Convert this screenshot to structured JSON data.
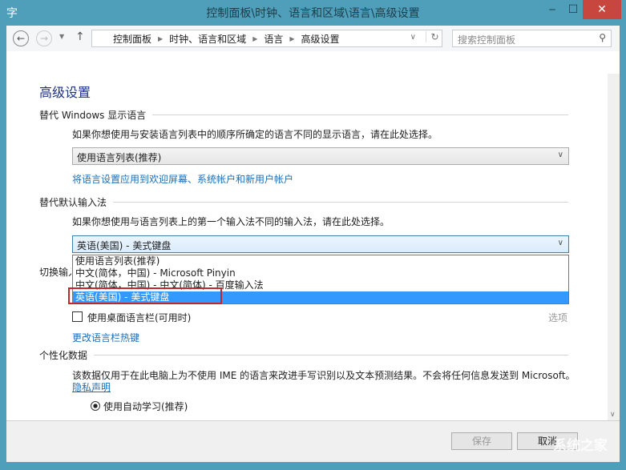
{
  "window": {
    "title": "控制面板\\时钟、语言和区域\\语言\\高级设置"
  },
  "nav": {
    "breadcrumb": [
      "控制面板",
      "时钟、语言和区域",
      "语言",
      "高级设置"
    ],
    "search_placeholder": "搜索控制面板"
  },
  "page": {
    "heading": "高级设置",
    "display_lang": {
      "title": "替代 Windows 显示语言",
      "desc": "如果你想使用与安装语言列表中的顺序所确定的语言不同的显示语言，请在此处选择。",
      "value": "使用语言列表(推荐)",
      "link": "将语言设置应用到欢迎屏幕、系统帐户和新用户帐户"
    },
    "input_method": {
      "title": "替代默认输入法",
      "desc": "如果你想使用与语言列表上的第一个输入法不同的输入法，请在此处选择。",
      "value": "英语(美国) - 美式键盘",
      "options": [
        "使用语言列表(推荐)",
        "中文(简体，中国) - Microsoft Pinyin",
        "中文(简体，中国) - 中文(简体) - 百度输入法",
        "英语(美国) - 美式键盘"
      ],
      "selected_index": 3
    },
    "switch": {
      "title": "切换输入法",
      "checkbox": "使用桌面语言栏(可用时)",
      "checked": false,
      "options_link": "选项",
      "hotkey_link": "更改语言栏热键"
    },
    "personal": {
      "title": "个性化数据",
      "desc": "该数据仅用于在此电脑上为不使用 IME 的语言来改进手写识别以及文本预测结果。不会将任何信息发送到 Microsoft。",
      "privacy_link": "隐私声明",
      "radio": "使用自动学习(推荐)"
    }
  },
  "footer": {
    "save": "保存",
    "cancel": "取消"
  },
  "watermark": "系统之家"
}
